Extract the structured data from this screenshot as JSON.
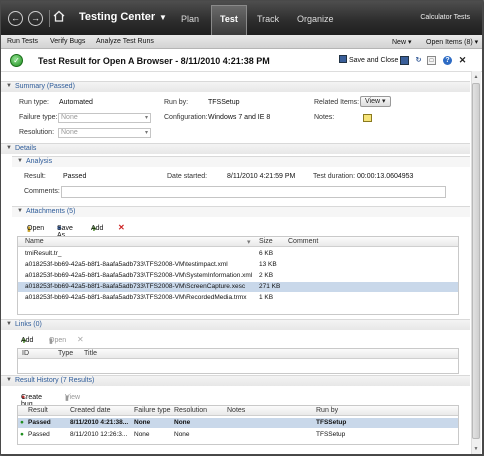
{
  "topbar": {
    "app_title": "Testing Center",
    "tabs": [
      "Plan",
      "Test",
      "Track",
      "Organize"
    ],
    "project": "Calculator Tests"
  },
  "menubar": {
    "left": [
      "Run Tests",
      "Verify Bugs",
      "Analyze Test Runs"
    ],
    "new_label": "New",
    "open_label": "Open Items (8)"
  },
  "header": {
    "title": "Test Result for Open A Browser - 8/11/2010 4:21:38 PM",
    "save_close": "Save and Close"
  },
  "summary": {
    "section": "Summary (Passed)",
    "run_type_label": "Run type:",
    "run_type": "Automated",
    "run_by_label": "Run by:",
    "run_by": "TFSSetup",
    "related_label": "Related Items:",
    "view_label": "View",
    "failure_label": "Failure type:",
    "failure_placeholder": "None",
    "config_label": "Configuration:",
    "config": "Windows 7 and IE 8",
    "notes_label": "Notes:",
    "resolution_label": "Resolution:",
    "resolution_placeholder": "None"
  },
  "details": {
    "section": "Details",
    "analysis_section": "Analysis",
    "result_label": "Result:",
    "result": "Passed",
    "started_label": "Date started:",
    "started": "8/11/2010 4:21:59 PM",
    "duration_label": "Test duration:",
    "duration": "00:00:13.0604953",
    "comments_label": "Comments:"
  },
  "attachments": {
    "section": "Attachments (5)",
    "toolbar": [
      "Open",
      "Save As",
      "Add"
    ],
    "columns": [
      "Name",
      "Size",
      "Comment"
    ],
    "rows": [
      {
        "name": "tmiResult.tr_",
        "size": "6 KB"
      },
      {
        "name": "a018253f-bb69-42a5-b8f1-8aafa5adb733\\TFS2008-VM\\testimpact.xml",
        "size": "13 KB"
      },
      {
        "name": "a018253f-bb69-42a5-b8f1-8aafa5adb733\\TFS2008-VM\\SystemInformation.xml",
        "size": "2 KB"
      },
      {
        "name": "a018253f-bb69-42a5-b8f1-8aafa5adb733\\TFS2008-VM\\ScreenCapture.xesc",
        "size": "271 KB"
      },
      {
        "name": "a018253f-bb69-42a5-b8f1-8aafa5adb733\\TFS2008-VM\\RecordedMedia.trmx",
        "size": "1 KB"
      }
    ]
  },
  "links": {
    "section": "Links (0)",
    "toolbar": [
      "Add",
      "Open"
    ],
    "columns": [
      "ID",
      "Type",
      "Title"
    ]
  },
  "history": {
    "section": "Result History (7 Results)",
    "toolbar": [
      "Create bug",
      "View"
    ],
    "columns": [
      "Result",
      "Created date",
      "Failure type",
      "Resolution",
      "Notes",
      "Run by"
    ],
    "rows": [
      {
        "result": "Passed",
        "date": "8/11/2010 4:21:38...",
        "failure": "None",
        "resolution": "None",
        "notes": "",
        "runby": "TFSSetup"
      },
      {
        "result": "Passed",
        "date": "8/11/2010 12:26:3...",
        "failure": "None",
        "resolution": "None",
        "notes": "",
        "runby": "TFSSetup"
      }
    ]
  },
  "colors": {
    "accent": "#2d5b99",
    "selection": "#c9d8ea",
    "topbar": "#2c2c2c"
  }
}
